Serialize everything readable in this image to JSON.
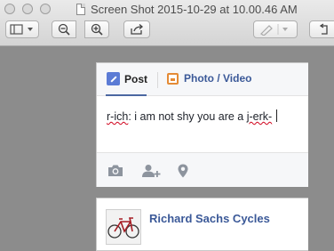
{
  "window": {
    "title": "Screen Shot 2015-10-29 at 10.00.46 AM"
  },
  "toolbar": {
    "icons": [
      "sidebar-icon",
      "zoom-out-icon",
      "zoom-in-icon",
      "share-icon",
      "markup-pen-icon",
      "rotate-icon"
    ]
  },
  "composer": {
    "tabs": [
      {
        "label": "Post",
        "icon": "pencil-icon",
        "active": true
      },
      {
        "label": "Photo / Video",
        "icon": "photo-icon",
        "active": false
      }
    ],
    "input_text": {
      "part1": "r-ich",
      "part2": ": i am not shy you are a ",
      "part3": "j-erk-"
    },
    "actions": [
      "camera-icon",
      "tag-friends-icon",
      "location-pin-icon"
    ]
  },
  "feed": {
    "suggestion_name": "Richard Sachs Cycles",
    "thumbnail_icon": "bicycle-icon"
  },
  "colors": {
    "desktop_bg": "#8c8c8c",
    "facebook_link": "#3b5998",
    "spell_underline": "#d0021b"
  }
}
